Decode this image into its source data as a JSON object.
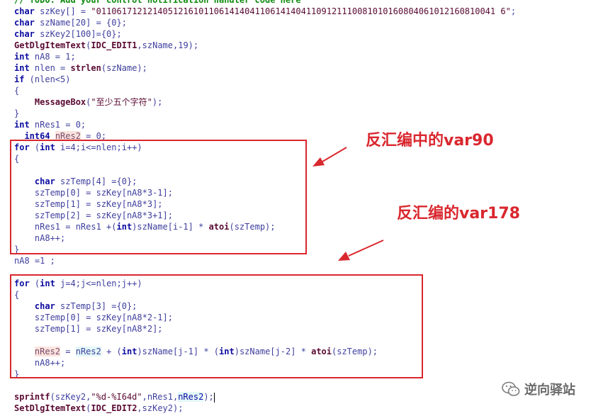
{
  "code_lines": [
    [
      {
        "t": "// TODO: Add your control notification handler code here",
        "c": "cm"
      }
    ],
    [
      {
        "t": "char",
        "c": "kw"
      },
      {
        "t": " szKey[] = ",
        "c": "id"
      },
      {
        "t": "\"011061712121405121610110614140411061414041109121110081010160804061012160810041 6\"",
        "c": "str"
      },
      {
        "t": ";",
        "c": "id"
      }
    ],
    [
      {
        "t": "char",
        "c": "kw"
      },
      {
        "t": " szName[20] = {0};",
        "c": "id"
      }
    ],
    [
      {
        "t": "char",
        "c": "kw"
      },
      {
        "t": " szKey2[100]={0};",
        "c": "id"
      }
    ],
    [
      {
        "t": "GetDlgItemText",
        "c": "fn"
      },
      {
        "t": "(",
        "c": "id"
      },
      {
        "t": "IDC_EDIT1",
        "c": "fn"
      },
      {
        "t": ",szName,19);",
        "c": "id"
      }
    ],
    [
      {
        "t": "int",
        "c": "kw"
      },
      {
        "t": " nA8 = 1;",
        "c": "id"
      }
    ],
    [
      {
        "t": "int",
        "c": "kw"
      },
      {
        "t": " nlen = ",
        "c": "id"
      },
      {
        "t": "strlen",
        "c": "fn"
      },
      {
        "t": "(szName);",
        "c": "id"
      }
    ],
    [
      {
        "t": "if",
        "c": "kw"
      },
      {
        "t": " (nlen<5)",
        "c": "id"
      }
    ],
    [
      {
        "t": "{",
        "c": "id"
      }
    ],
    [
      {
        "t": "    ",
        "c": "id"
      },
      {
        "t": "MessageBox",
        "c": "fn"
      },
      {
        "t": "(",
        "c": "id"
      },
      {
        "t": "\"至少五个字符\"",
        "c": "str"
      },
      {
        "t": ");",
        "c": "id"
      }
    ],
    [
      {
        "t": "}",
        "c": "id"
      }
    ],
    [
      {
        "t": "int",
        "c": "kw"
      },
      {
        "t": " nRes1 = 0;",
        "c": "id"
      }
    ],
    [
      {
        "t": "__int64",
        "c": "kw"
      },
      {
        "t": " ",
        "c": "id"
      },
      {
        "t": "nRes2",
        "c": "hlr"
      },
      {
        "t": " = 0;",
        "c": "id"
      }
    ],
    [
      {
        "t": "for",
        "c": "kw"
      },
      {
        "t": " (",
        "c": "id"
      },
      {
        "t": "int",
        "c": "kw"
      },
      {
        "t": " i=4;i<=nlen;i++)",
        "c": "id"
      }
    ],
    [
      {
        "t": "{",
        "c": "id"
      }
    ],
    [
      {
        "t": "",
        "c": "id"
      }
    ],
    [
      {
        "t": "    ",
        "c": "id"
      },
      {
        "t": "char",
        "c": "kw"
      },
      {
        "t": " szTemp[4] ={0};",
        "c": "id"
      }
    ],
    [
      {
        "t": "    szTemp[0] = szKey[nA8*3-1];",
        "c": "id"
      }
    ],
    [
      {
        "t": "    szTemp[1] = szKey[nA8*3];",
        "c": "id"
      }
    ],
    [
      {
        "t": "    szTemp[2] = szKey[nA8*3+1];",
        "c": "id"
      }
    ],
    [
      {
        "t": "    nRes1 = nRes1 +(",
        "c": "id"
      },
      {
        "t": "int",
        "c": "kw"
      },
      {
        "t": ")szName[i-1] * ",
        "c": "id"
      },
      {
        "t": "atoi",
        "c": "fn"
      },
      {
        "t": "(szTemp);",
        "c": "id"
      }
    ],
    [
      {
        "t": "    nA8++;",
        "c": "id"
      }
    ],
    [
      {
        "t": "}",
        "c": "id"
      }
    ],
    [
      {
        "t": "nA8 =1 ;",
        "c": "id"
      }
    ],
    [
      {
        "t": "",
        "c": "id"
      }
    ],
    [
      {
        "t": "for",
        "c": "kw"
      },
      {
        "t": " (",
        "c": "id"
      },
      {
        "t": "int",
        "c": "kw"
      },
      {
        "t": " j=4;j<=nlen;j++)",
        "c": "id"
      }
    ],
    [
      {
        "t": "{",
        "c": "id"
      }
    ],
    [
      {
        "t": "    ",
        "c": "id"
      },
      {
        "t": "char",
        "c": "kw"
      },
      {
        "t": " szTemp[3] ={0};",
        "c": "id"
      }
    ],
    [
      {
        "t": "    szTemp[0] = szKey[nA8*2-1];",
        "c": "id"
      }
    ],
    [
      {
        "t": "    szTemp[1] = szKey[nA8*2];",
        "c": "id"
      }
    ],
    [
      {
        "t": "",
        "c": "id"
      }
    ],
    [
      {
        "t": "    ",
        "c": "id"
      },
      {
        "t": "nRes2",
        "c": "hlr"
      },
      {
        "t": " = ",
        "c": "id"
      },
      {
        "t": "nRes2",
        "c": "hlc"
      },
      {
        "t": " + (",
        "c": "id"
      },
      {
        "t": "int",
        "c": "kw"
      },
      {
        "t": ")szName[j-1] * (",
        "c": "id"
      },
      {
        "t": "int",
        "c": "kw"
      },
      {
        "t": ")szName[j-2] * ",
        "c": "id"
      },
      {
        "t": "atoi",
        "c": "fn"
      },
      {
        "t": "(szTemp);",
        "c": "id"
      }
    ],
    [
      {
        "t": "    nA8++;",
        "c": "id"
      }
    ],
    [
      {
        "t": "}",
        "c": "id"
      }
    ],
    [
      {
        "t": "",
        "c": "id"
      }
    ],
    [
      {
        "t": "sprintf",
        "c": "fn"
      },
      {
        "t": "(szKey2,",
        "c": "id"
      },
      {
        "t": "\"%d-%I64d\"",
        "c": "str"
      },
      {
        "t": ",nRes1,",
        "c": "id"
      },
      {
        "t": "nRes2",
        "c": "hlc2"
      },
      {
        "t": ");",
        "c": "id"
      },
      {
        "t": "",
        "c": "caret"
      }
    ],
    [
      {
        "t": "SetDlgItemText",
        "c": "fn"
      },
      {
        "t": "(",
        "c": "id"
      },
      {
        "t": "IDC_EDIT2",
        "c": "fn"
      },
      {
        "t": ",szKey2);",
        "c": "id"
      }
    ]
  ],
  "annotations": {
    "var90": "反汇编中的var90",
    "var178": "反汇编的var178"
  },
  "watermark": {
    "text": "逆向驿站",
    "icon": "wechat-icon"
  },
  "colors": {
    "keyword": "#0b0ba0",
    "identifier": "#3f3f9f",
    "function": "#5a0a32",
    "comment": "#0d8a0d",
    "annotation_red": "#d9272e",
    "highlight_red_bg": "#fbe3de",
    "highlight_cyan_bg": "#e3f7f6"
  }
}
